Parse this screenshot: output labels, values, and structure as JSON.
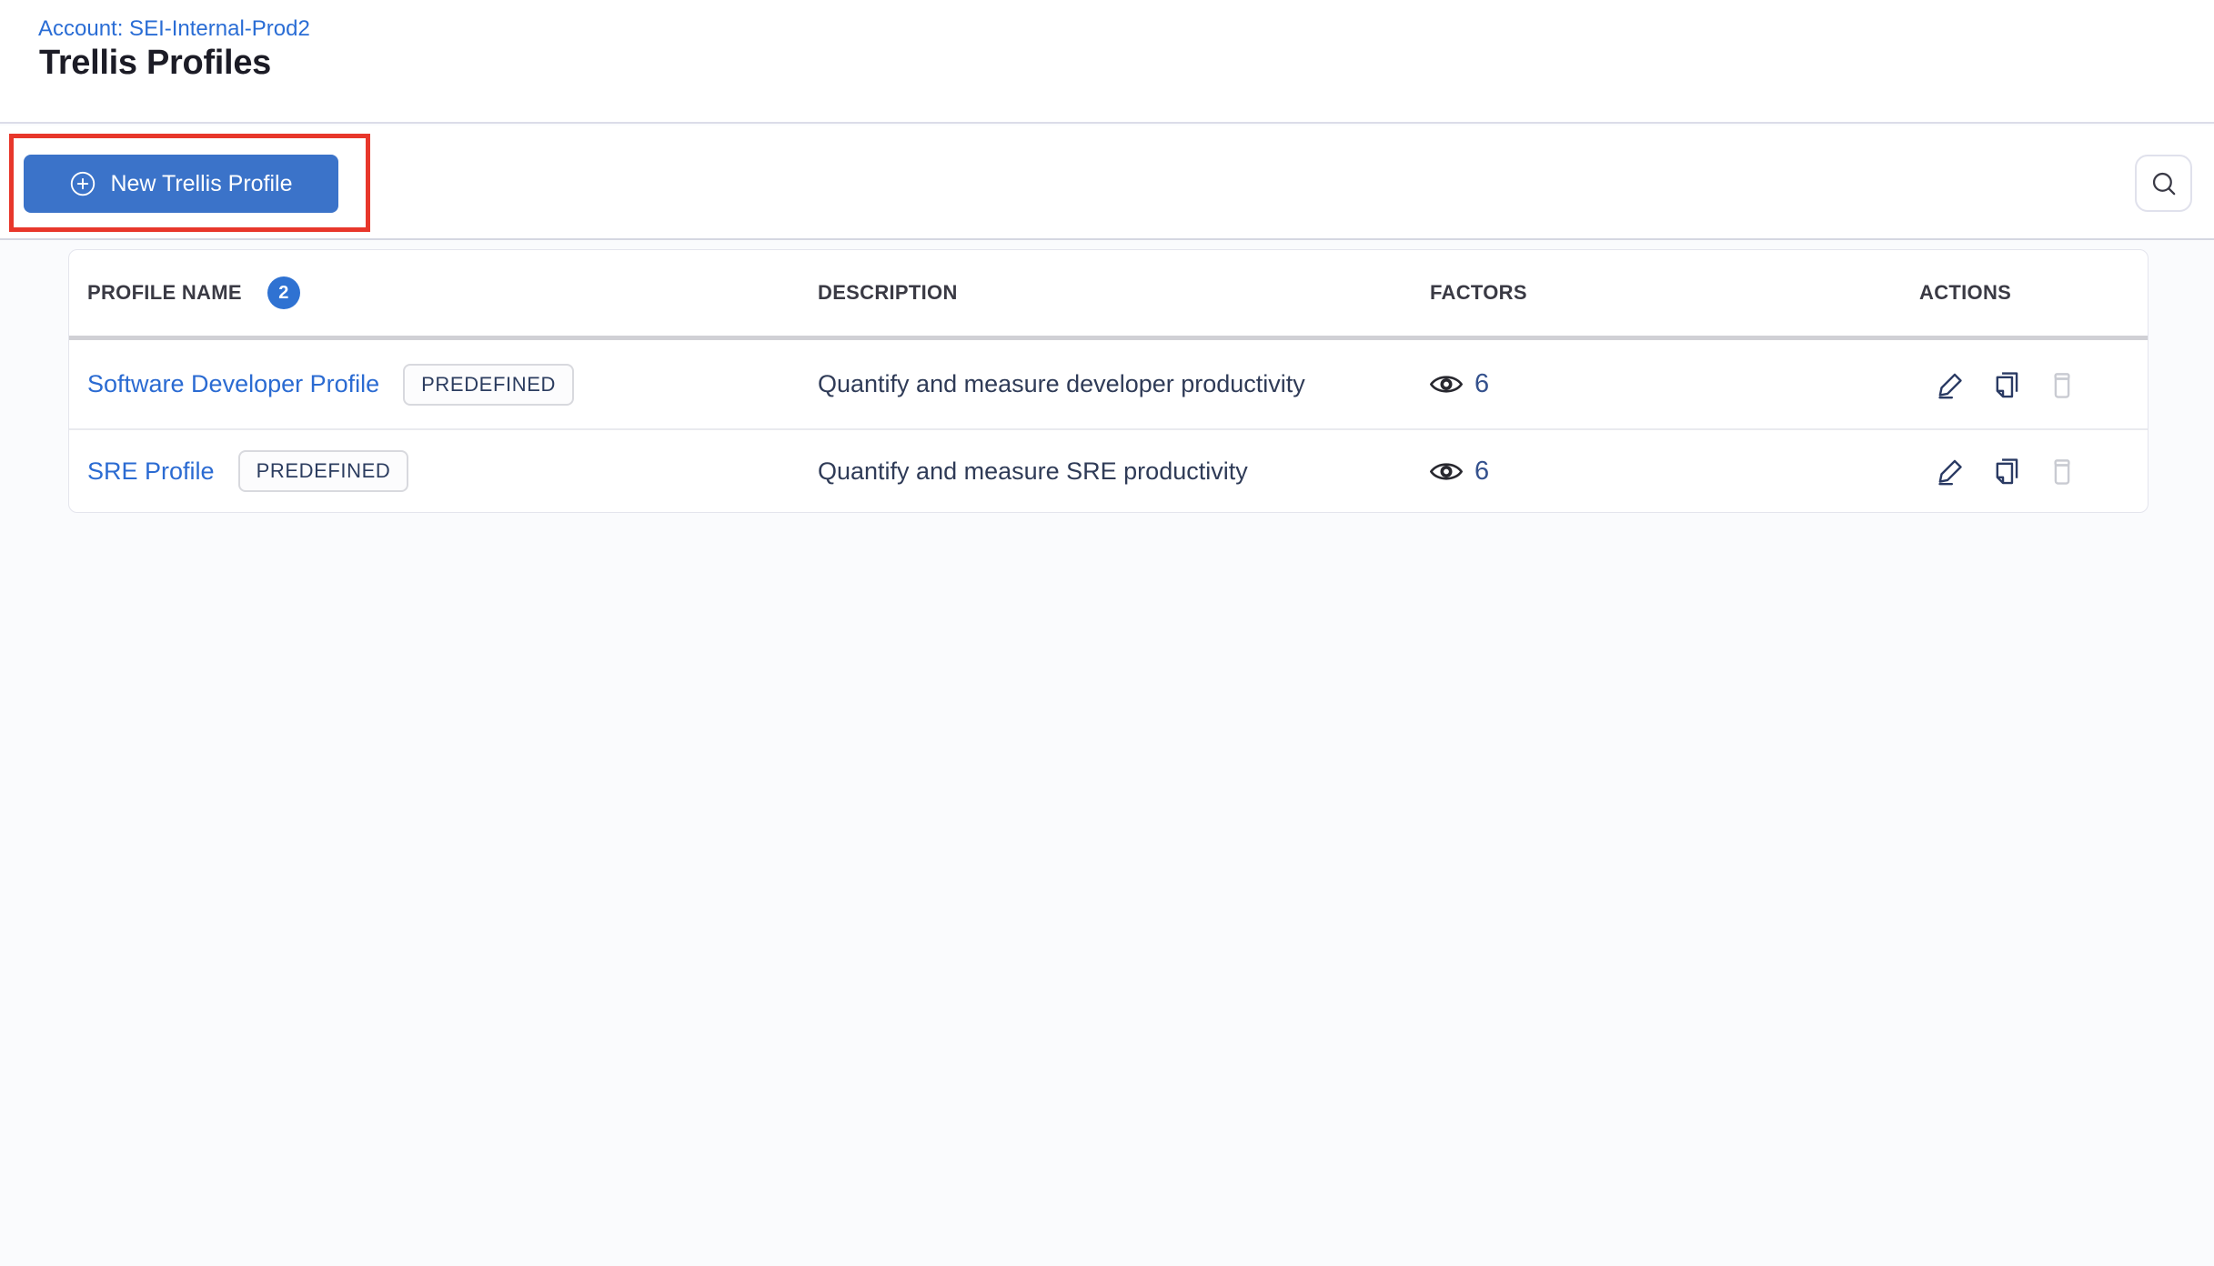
{
  "header": {
    "account_link": "Account: SEI-Internal-Prod2",
    "title": "Trellis Profiles"
  },
  "toolbar": {
    "new_profile_button": "New Trellis Profile",
    "new_profile_icon": "plus-circle-icon",
    "search_icon": "magnifier-icon"
  },
  "table": {
    "headers": {
      "profile_name": "PROFILE NAME",
      "count_badge": "2",
      "description": "DESCRIPTION",
      "factors": "FACTORS",
      "actions": "ACTIONS"
    },
    "factors_icon": "eye-icon",
    "action_icons": [
      "edit-pencil-icon",
      "copy-icon",
      "trash-icon"
    ],
    "rows": [
      {
        "name": "Software Developer Profile",
        "tag": "PREDEFINED",
        "description": "Quantify and measure developer productivity",
        "factors_count": "6"
      },
      {
        "name": "SRE Profile",
        "tag": "PREDEFINED",
        "description": "Quantify and measure SRE productivity",
        "factors_count": "6"
      }
    ]
  },
  "colors": {
    "primary_button_blue": "#3b73c9",
    "link_blue": "#2b6bd2",
    "badge_blue": "#2f72d2",
    "annotation_red": "#e8372b",
    "action_icon_navy": "#2a3a63",
    "disabled_icon_gray": "#c9cbd2",
    "page_background": "#fafbfd"
  }
}
